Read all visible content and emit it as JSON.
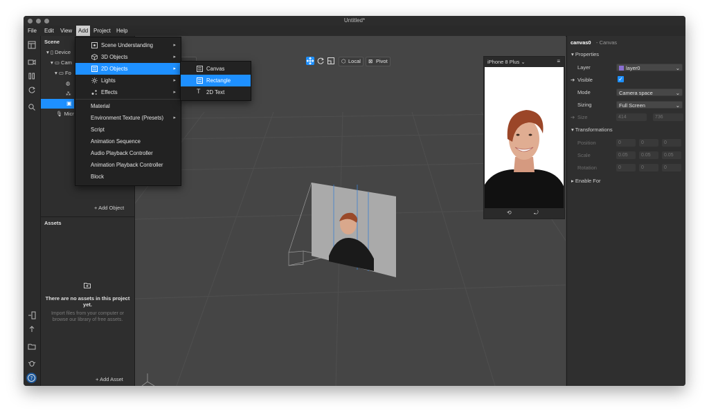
{
  "window": {
    "title": "Untitled*"
  },
  "menubar": [
    "File",
    "Edit",
    "View",
    "Add",
    "Project",
    "Help"
  ],
  "scene": {
    "header": "Scene",
    "items": [
      "Device",
      "Cam",
      "Fo",
      "Micr"
    ],
    "add_object": "Add Object"
  },
  "assets": {
    "header": "Assets",
    "empty_title": "There are no assets in this project yet.",
    "empty_hint": "Import files from your computer or browse our library of free assets.",
    "add_asset": "Add Asset"
  },
  "add_menu": {
    "items": [
      {
        "label": "Scene Understanding",
        "submenu": true,
        "icon": "scene-understanding-icon"
      },
      {
        "label": "3D Objects",
        "submenu": true,
        "icon": "cube-icon"
      },
      {
        "label": "2D Objects",
        "submenu": true,
        "icon": "square-icon",
        "selected": true
      },
      {
        "label": "Lights",
        "submenu": true,
        "icon": "light-icon"
      },
      {
        "label": "Effects",
        "submenu": true,
        "icon": "effects-icon"
      },
      {
        "label": "Material"
      },
      {
        "label": "Environment Texture (Presets)",
        "submenu": true
      },
      {
        "label": "Script"
      },
      {
        "label": "Animation Sequence"
      },
      {
        "label": "Audio Playback Controller"
      },
      {
        "label": "Animation Playback Controller"
      },
      {
        "label": "Block"
      }
    ]
  },
  "submenu_2d": {
    "items": [
      {
        "label": "Canvas",
        "icon": "canvas-icon"
      },
      {
        "label": "Rectangle",
        "icon": "rectangle-icon",
        "selected": true
      },
      {
        "label": "2D Text",
        "icon": "text-icon"
      }
    ]
  },
  "viewport_toolbar": {
    "local": "Local",
    "pivot": "Pivot",
    "partial": "r"
  },
  "simulator": {
    "device": "iPhone 8 Plus"
  },
  "inspector": {
    "object_name": "canvas0",
    "object_type": "- Canvas",
    "properties_header": "Properties",
    "layer_label": "Layer",
    "layer_value": "layer0",
    "visible_label": "Visible",
    "mode_label": "Mode",
    "mode_value": "Camera space",
    "sizing_label": "Sizing",
    "sizing_value": "Full Screen",
    "size_label": "Size",
    "size_w": "414",
    "size_h": "736",
    "transformations_header": "Transformations",
    "position_label": "Position",
    "position": [
      "0",
      "0",
      "0"
    ],
    "scale_label": "Scale",
    "scale": [
      "0.05",
      "0.05",
      "0.05"
    ],
    "rotation_label": "Rotation",
    "rotation": [
      "0",
      "0",
      "0"
    ],
    "enable_for": "Enable For"
  },
  "colors": {
    "accent": "#1e90ff",
    "layer_swatch": "#8a6fd1",
    "bg": "#454545"
  }
}
